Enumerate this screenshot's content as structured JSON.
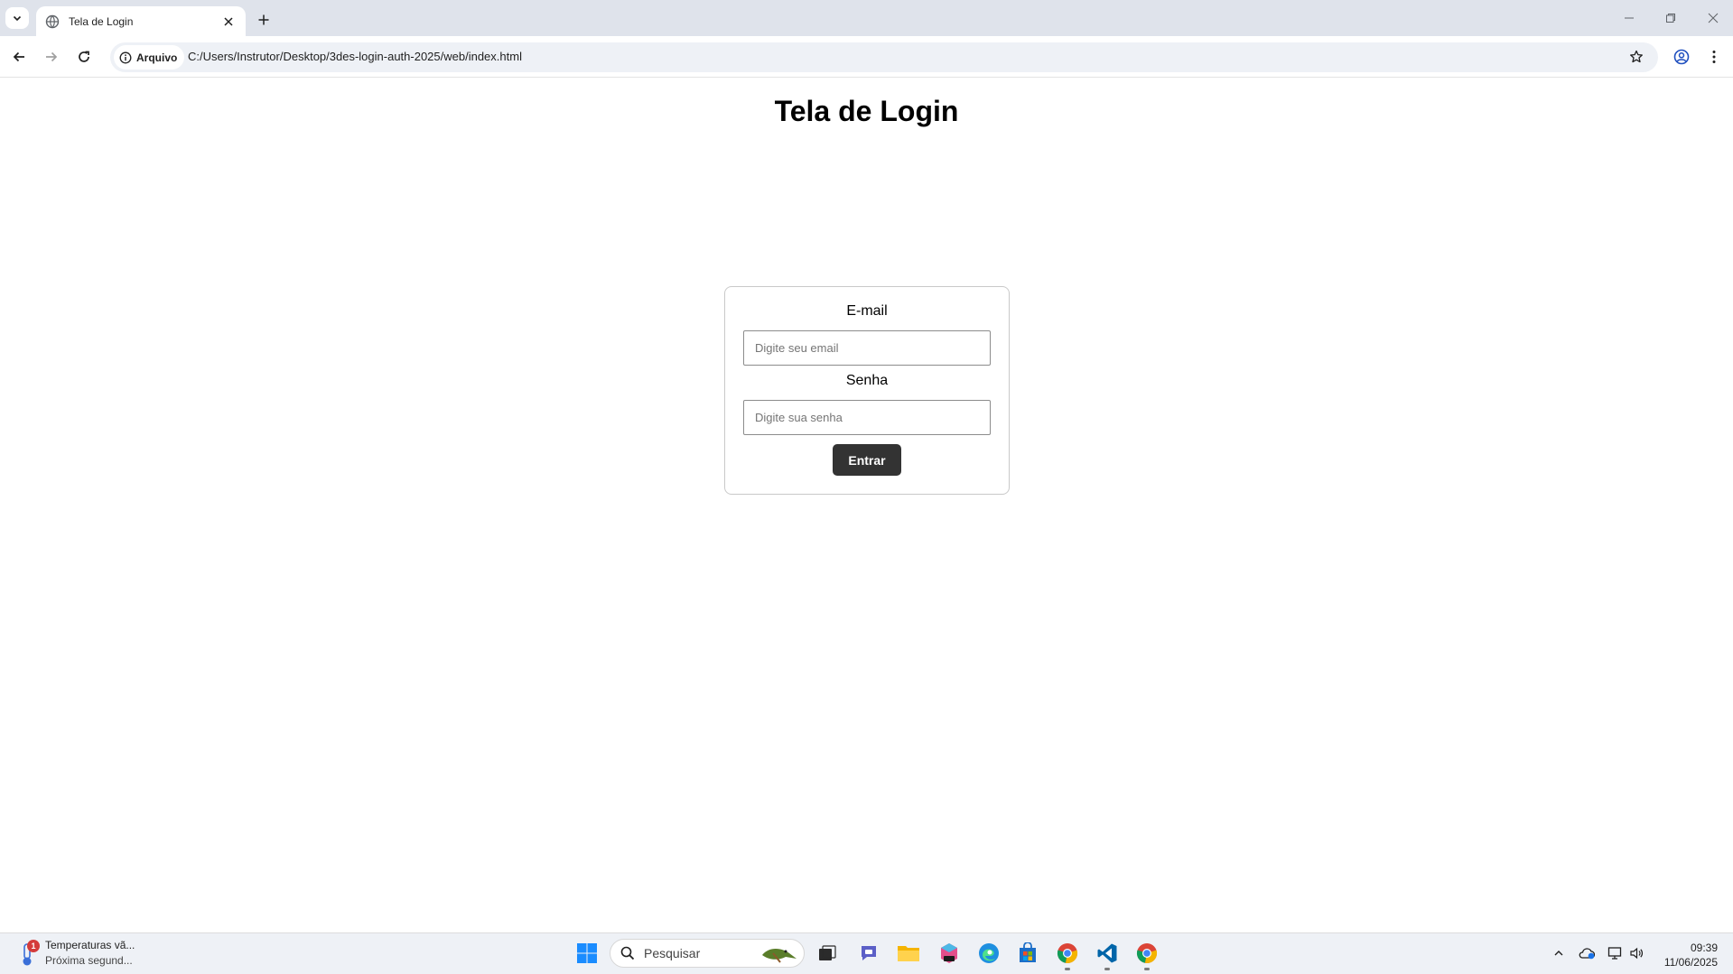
{
  "browser": {
    "tab": {
      "title": "Tela de Login"
    },
    "address": {
      "security_label": "Arquivo",
      "url": "C:/Users/Instrutor/Desktop/3des-login-auth-2025/web/index.html"
    }
  },
  "page": {
    "title": "Tela de Login",
    "email": {
      "label": "E-mail",
      "placeholder": "Digite seu email"
    },
    "password": {
      "label": "Senha",
      "placeholder": "Digite sua senha"
    },
    "submit_label": "Entrar"
  },
  "taskbar": {
    "weather": {
      "badge": "1",
      "line1": "Temperaturas vã...",
      "line2": "Próxima segund..."
    },
    "search_placeholder": "Pesquisar",
    "pinned_apps": [
      "start-icon",
      "search-icon",
      "task-view-icon",
      "chat-icon",
      "file-explorer-icon",
      "microsoft-365-icon",
      "edge-icon",
      "store-icon",
      "chrome-icon",
      "vscode-icon",
      "chrome-icon"
    ],
    "clock": {
      "time": "09:39",
      "date": "11/06/2025"
    }
  },
  "colors": {
    "button_bg": "#333333",
    "tabstrip_bg": "#dfe3eb",
    "taskbar_bg": "#eef1f6"
  }
}
